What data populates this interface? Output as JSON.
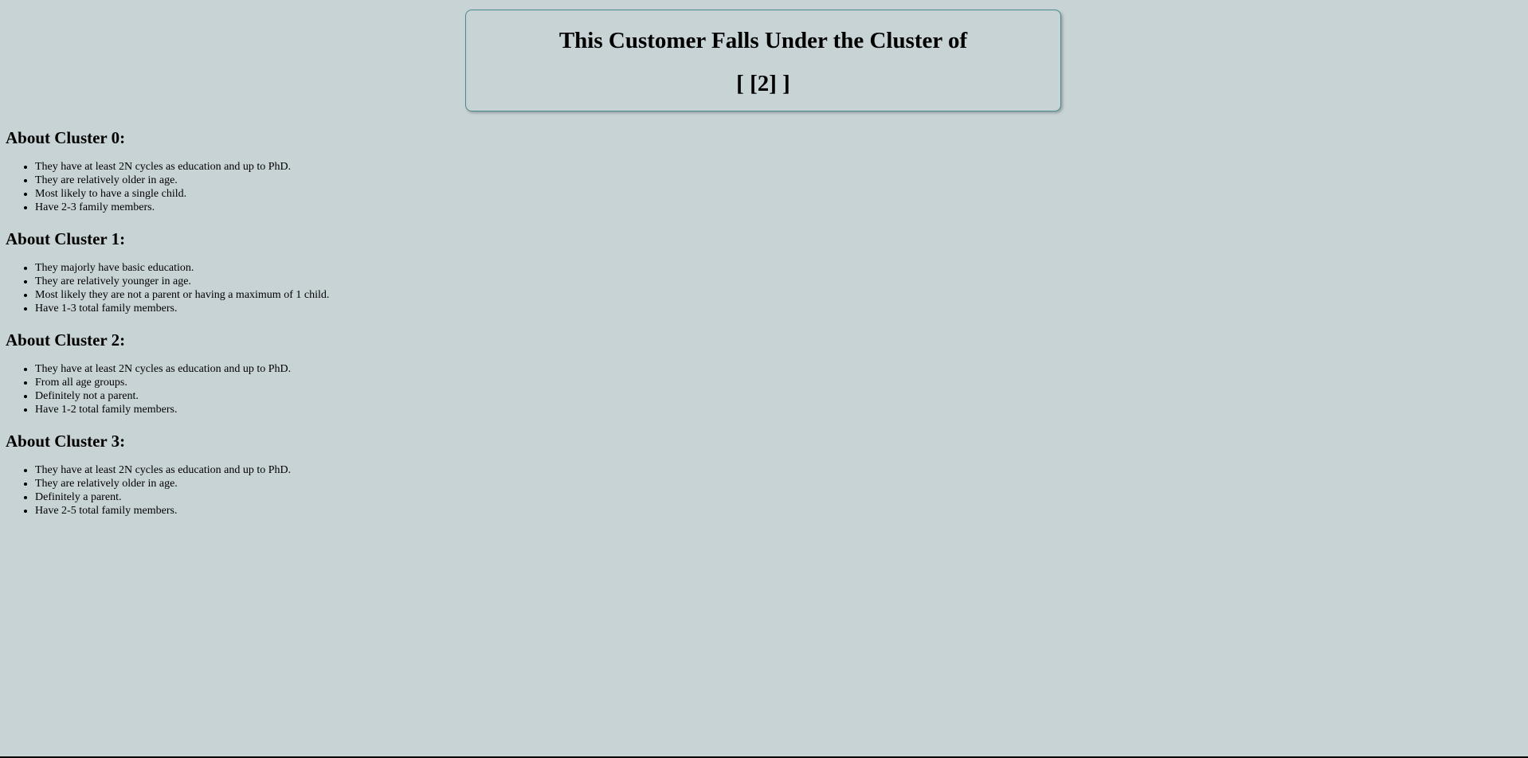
{
  "result": {
    "title": "This Customer Falls Under the Cluster of",
    "value": "[ [2] ]"
  },
  "clusters": [
    {
      "heading": "About Cluster 0:",
      "items": [
        "They have at least 2N cycles as education and up to PhD.",
        "They are relatively older in age.",
        "Most likely to have a single child.",
        "Have 2-3 family members."
      ]
    },
    {
      "heading": "About Cluster 1:",
      "items": [
        "They majorly have basic education.",
        "They are relatively younger in age.",
        "Most likely they are not a parent or having a maximum of 1 child.",
        "Have 1-3 total family members."
      ]
    },
    {
      "heading": "About Cluster 2:",
      "items": [
        "They have at least 2N cycles as education and up to PhD.",
        "From all age groups.",
        "Definitely not a parent.",
        "Have 1-2 total family members."
      ]
    },
    {
      "heading": "About Cluster 3:",
      "items": [
        "They have at least 2N cycles as education and up to PhD.",
        "They are relatively older in age.",
        "Definitely a parent.",
        "Have 2-5 total family members."
      ]
    }
  ]
}
